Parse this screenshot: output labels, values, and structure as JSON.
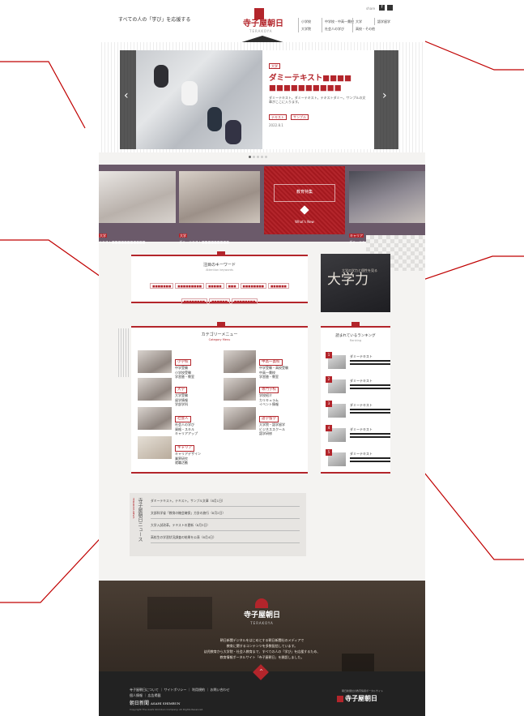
{
  "header": {
    "tagline": "すべての人の「学び」を応援する",
    "logo_main": "寺子屋朝日",
    "logo_sub": "TERAKOYA",
    "share_label": "share",
    "nav_col1": [
      "大学院",
      "社会人の学び"
    ],
    "nav_col2": [
      "小学校",
      "中学校・中高一貫校"
    ],
    "nav_col3": [
      "中学校・中高一貫校",
      "高校・その他"
    ],
    "nav_col4": [
      "大学",
      "キャリア"
    ],
    "nav_col5": [
      "語学留学",
      ""
    ]
  },
  "hero": {
    "tag": "大学",
    "title_line1": "ダミーテキスト■■■■",
    "title_line2": "■■■■■■■■■■",
    "body": "ダミーテキスト。ダミーテキスト。テキストダミー。サンプルの文章がここに入ります。",
    "chips": [
      "テキスト",
      "サンプル"
    ],
    "date": "2022.8.1",
    "prev_arrow": "‹",
    "next_arrow": "›"
  },
  "features": [
    {
      "tag": "大学",
      "caption": "テキスト■■■■■■■■■■■"
    },
    {
      "tag": "大学",
      "caption": "ダミーテキスト■■■■■■■■■"
    },
    {
      "tag": "キャリア",
      "caption": "ダミーテキスト■■■■■■■■■"
    }
  ],
  "feature_center": {
    "title": "教育特集",
    "subtitle": "What's New"
  },
  "keywords": {
    "title": "注目のキーワード",
    "subtitle": "Attention keywords",
    "items": [
      "■■■■■■■",
      "■■■■■■■■■",
      "■■■■■",
      "■■■",
      "■■■■■■■■",
      "■■■■■■",
      "■■■■■■■■",
      "■■■■■■",
      "■■■■■■■■"
    ]
  },
  "banner": {
    "text": "大学力",
    "sub": "大学の学力と個性を見る"
  },
  "categories": {
    "title": "カテゴリーメニュー",
    "subtitle": "Category Menu",
    "items": [
      {
        "tag": "小学校",
        "lines": [
          "中学受験",
          "小学校受験",
          "学習塾・教室"
        ]
      },
      {
        "tag": "中高一貫校",
        "lines": [
          "中学受験・高校受験",
          "中高一貫校",
          "学習塾・教室"
        ]
      },
      {
        "tag": "大学",
        "lines": [
          "大学受験",
          "留学情報",
          "学部学科"
        ]
      },
      {
        "tag": "専門学校",
        "lines": [
          "学校紹介",
          "カリキュラム",
          "イベント情報"
        ]
      },
      {
        "tag": "社会人",
        "lines": [
          "社会人の学び",
          "資格・スキル",
          "キャリアアップ"
        ]
      },
      {
        "tag": "語学留学",
        "lines": [
          "大学院・語学留学",
          "ビジネススクール",
          "語学研修"
        ]
      },
      {
        "tag": "キャリア",
        "lines": [
          "キャリアデザイン",
          "業界研究",
          "就職活動"
        ]
      }
    ]
  },
  "ranking": {
    "title": "読まれているランキング",
    "subtitle": "Ranking",
    "items": [
      {
        "num": "1",
        "label": "ダミーテキスト"
      },
      {
        "num": "2",
        "label": "ダミーテキスト"
      },
      {
        "num": "3",
        "label": "ダミーテキスト"
      },
      {
        "num": "4",
        "label": "ダミーテキスト"
      },
      {
        "num": "5",
        "label": "ダミーテキスト"
      }
    ]
  },
  "news": {
    "vertical_title": "寺子屋朝日ニュース",
    "vertical_sub": "TERAKOYA NEWS",
    "items": [
      "ダミーテキスト。テキスト。サンプル文章（8月1日）",
      "文部科学省「教育の機会確保」方針の施行（8月2日）",
      "大学入試改革。テキストの更新（8月3日）",
      "高校生の学習状況調査の結果を公表（8月4日）"
    ]
  },
  "footer": {
    "logo": "寺子屋朝日",
    "logo_sub": "TERAKOYA",
    "lines": [
      "朝日新聞デジタルをはじめとする朝日新聞社のメディアで",
      "教育に関するコンテンツを多数配信しています。",
      "幼児教育から大学院・社会人教育まで、すべての人の「学び」を応援するため、",
      "教育情報ポータルサイト「寺子屋朝日」を開設しました。"
    ],
    "links": [
      "寺子屋朝日について",
      "サイトポリシー",
      "利用規約",
      "お問い合わせ",
      "個人情報",
      "広告掲載"
    ],
    "company": "朝日新聞",
    "company_en": "ASAHI SHIMBUN",
    "copyright": "Copyright The Asahi Shimbun Company. All Rights Reserved.",
    "right_small": "朝日新聞社の教育情報ポータルサイト"
  },
  "colors": {
    "accent": "#b3252b",
    "band": "#6b5a6a"
  }
}
